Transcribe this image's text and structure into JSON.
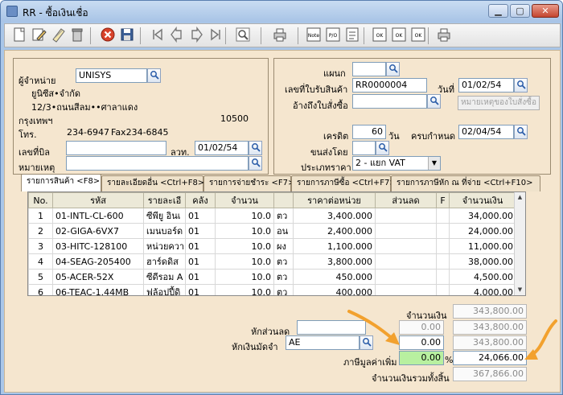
{
  "window": {
    "title": "RR - ซื้อเงินเชื่อ"
  },
  "toolbar": {
    "buttons": [
      {
        "name": "new-icon"
      },
      {
        "name": "edit-icon"
      },
      {
        "name": "copy-icon"
      },
      {
        "name": "delete-icon"
      },
      {
        "name": "cancel-icon"
      },
      {
        "name": "save-icon"
      },
      {
        "name": "first-record-icon"
      },
      {
        "name": "previous-record-icon"
      },
      {
        "name": "next-record-icon"
      },
      {
        "name": "last-record-icon"
      },
      {
        "name": "search-icon"
      },
      {
        "name": "print-icon"
      },
      {
        "name": "note-icon",
        "text": "Note"
      },
      {
        "name": "po-icon",
        "text": "P/O"
      },
      {
        "name": "tax-icon"
      },
      {
        "name": "approve-icon",
        "text": "OK"
      },
      {
        "name": "approve-sign-icon",
        "text": "OK"
      },
      {
        "name": "approve-doc-icon",
        "text": "OK"
      },
      {
        "name": "printer-icon"
      }
    ]
  },
  "supplier": {
    "label": "ผู้จำหน่าย",
    "code": "UNISYS",
    "name": "ยูนิซีส•จำกัด",
    "address1": "12/3•ถนนสีลม••ศาลาแดง",
    "city": "กรุงเทพฯ",
    "postcode": "10500",
    "phone_label": "โทร.",
    "phone": "234-6947",
    "fax": "Fax234-6845",
    "bill_no_label": "เลขที่บิล",
    "bill_no": "",
    "date_label": "ลวท.",
    "date": "01/02/54",
    "note_label": "หมายเหตุ",
    "note": ""
  },
  "doc": {
    "dept_label": "แผนก",
    "dept": "",
    "receipt_no_label": "เลขที่ใบรับสินค้า",
    "receipt_no": "RR0000004",
    "date_label": "วันที่",
    "date": "01/02/54",
    "po_ref_label": "อ้างถึงใบสั่งซื้อ",
    "po_ref": "",
    "po_note_button": "หมายเหตุของใบสั่งซื้อ",
    "credit_label": "เครดิต",
    "credit_days": "60",
    "days_label": "วัน",
    "due_label": "ครบกำหนด",
    "due_date": "02/04/54",
    "ship_label": "ขนส่งโดย",
    "ship": "",
    "price_type_label": "ประเภทราคา",
    "price_type": "2 - แยก VAT"
  },
  "tabs": [
    "รายการสินค้า <F8>",
    "รายละเอียดอื่น <Ctrl+F8>",
    "รายการจ่ายชำระ <F7>",
    "รายการภาษีซื้อ <Ctrl+F7>",
    "รายการภาษีหัก ณ ที่จ่าย <Ctrl+F10>"
  ],
  "grid": {
    "headers": [
      "No.",
      "รหัส",
      "รายละเอี",
      "คลัง",
      "จำนวน",
      "",
      "ราคาต่อหน่วย",
      "ส่วนลด",
      "F",
      "จำนวนเงิน"
    ],
    "rows": [
      [
        "1",
        "01-INTL-CL-600",
        "ซีพียู อินเ",
        "01",
        "10.0",
        "ตว",
        "3,400.000",
        "",
        "",
        "34,000.00"
      ],
      [
        "2",
        "02-GIGA-6VX7",
        "เมนบอร์ด",
        "01",
        "10.0",
        "อน",
        "2,400.000",
        "",
        "",
        "24,000.00"
      ],
      [
        "3",
        "03-HITC-128100",
        "หน่วยควา",
        "01",
        "10.0",
        "ผง",
        "1,100.000",
        "",
        "",
        "11,000.00"
      ],
      [
        "4",
        "04-SEAG-205400",
        "ฮาร์ดดิส",
        "01",
        "10.0",
        "ตว",
        "3,800.000",
        "",
        "",
        "38,000.00"
      ],
      [
        "5",
        "05-ACER-52X",
        "ซีดีรอม A",
        "01",
        "10.0",
        "ตว",
        "450.000",
        "",
        "",
        "4,500.00"
      ],
      [
        "6",
        "06-TEAC-1.44MB",
        "ฟล้อปปี้ดิ",
        "01",
        "10.0",
        "ตว",
        "400.000",
        "",
        "",
        "4,000.00"
      ]
    ]
  },
  "totals": {
    "amount_label": "จำนวนเงิน",
    "amount": "343,800.00",
    "discount_label": "หักส่วนลด",
    "discount_input": "",
    "discount_value": "0.00",
    "discount_total": "343,800.00",
    "deposit_label": "หักเงินมัดจำ",
    "deposit_code": "AE",
    "deposit_value": "0.00",
    "deposit_total": "343,800.00",
    "vat_label": "ภาษีมูลค่าเพิ่ม",
    "vat_rate": "0.00",
    "percent": "%",
    "vat_amount": "24,066.00",
    "grand_label": "จำนวนเงินรวมทั้งสิ้น",
    "grand_total": "367,866.00"
  },
  "colors": {
    "arrow": "#f2a12e",
    "highlight": "#b8f0a0"
  }
}
